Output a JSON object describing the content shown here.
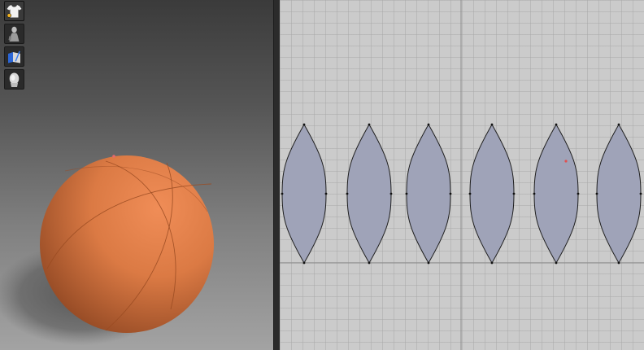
{
  "app": {
    "accent_color": "#e8844f",
    "fabric_color": "#9fa3b8"
  },
  "toolbar": {
    "items": [
      {
        "icon": "tshirt-icon",
        "active": true
      },
      {
        "icon": "avatar-icon",
        "active": false
      },
      {
        "icon": "fabric-icon",
        "active": false
      },
      {
        "icon": "head-icon",
        "active": false
      }
    ]
  },
  "viewport_3d": {
    "object": "sphere",
    "object_color": "#e8844f"
  },
  "viewport_2d": {
    "patterns": [
      {
        "name": "pattern-piece-1"
      },
      {
        "name": "pattern-piece-2"
      },
      {
        "name": "pattern-piece-3"
      },
      {
        "name": "pattern-piece-4"
      },
      {
        "name": "pattern-piece-5"
      },
      {
        "name": "pattern-piece-6"
      }
    ]
  }
}
